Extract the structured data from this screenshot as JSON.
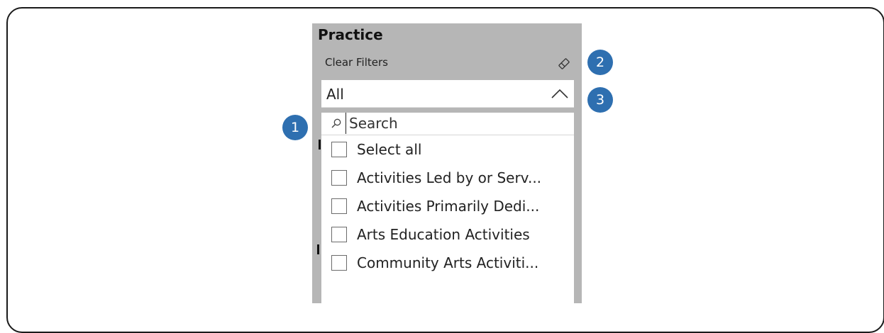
{
  "slicer": {
    "title": "Practice",
    "clear_filters_label": "Clear Filters",
    "eraser_icon": "eraser-icon",
    "dropdown_value": "All",
    "chevron_icon": "chevron-up-icon",
    "search_placeholder": "Search",
    "search_icon": "search-icon",
    "items": [
      {
        "label": "Select all",
        "checked": false
      },
      {
        "label": "Activities Led by or Serv...",
        "checked": false
      },
      {
        "label": "Activities Primarily Dedi...",
        "checked": false
      },
      {
        "label": "Arts Education Activities",
        "checked": false
      },
      {
        "label": "Community Arts Activiti...",
        "checked": false
      }
    ]
  },
  "callouts": [
    {
      "number": "1",
      "target": "search"
    },
    {
      "number": "2",
      "target": "clear-filters"
    },
    {
      "number": "3",
      "target": "dropdown"
    }
  ],
  "colors": {
    "panel_bg": "#b6b6b6",
    "callout_bg": "#2e6fb0"
  }
}
